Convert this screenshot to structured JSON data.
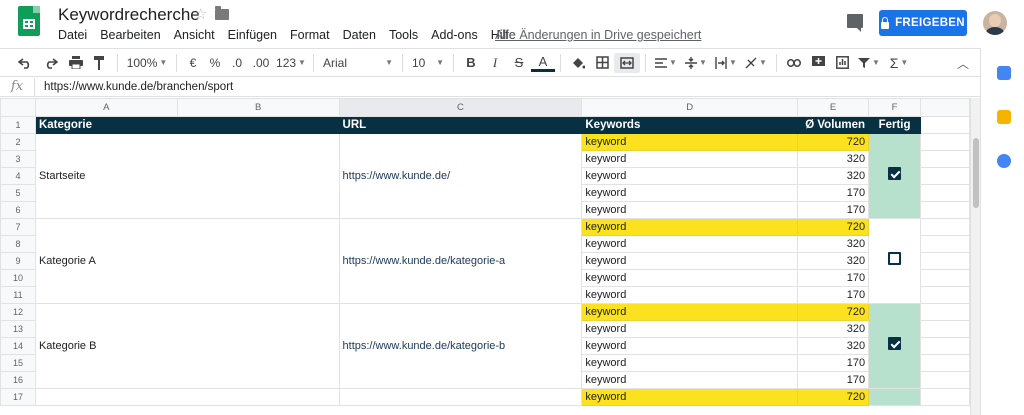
{
  "header": {
    "title": "Keywordrecherche",
    "menu": [
      "Datei",
      "Bearbeiten",
      "Ansicht",
      "Einfügen",
      "Format",
      "Daten",
      "Tools",
      "Add-ons",
      "Hilfe"
    ],
    "save_status": "Alle Änderungen in Drive gespeichert",
    "share_label": "FREIGEBEN"
  },
  "toolbar": {
    "zoom": "100%",
    "currency": "€",
    "percent": "%",
    "dec_less": ".0",
    "dec_more": ".00",
    "more_formats": "123",
    "font": "Arial",
    "font_size": "10",
    "bold": "B",
    "italic": "I",
    "strike": "S",
    "text_color": "A",
    "sum": "Σ"
  },
  "formula_bar": {
    "fx": "fx",
    "value": "https://www.kunde.de/branchen/sport"
  },
  "columns": [
    "A",
    "B",
    "C",
    "D",
    "E",
    "F"
  ],
  "rows": [
    "1",
    "2",
    "3",
    "4",
    "5",
    "6",
    "7",
    "8",
    "9",
    "10",
    "11",
    "12",
    "13",
    "14",
    "15",
    "16",
    "17"
  ],
  "table_header": {
    "kategorie": "Kategorie",
    "url": "URL",
    "keywords": "Keywords",
    "volumen": "Ø Volumen",
    "fertig": "Fertig"
  },
  "groups": [
    {
      "kategorie": "Startseite",
      "url": "https://www.kunde.de/",
      "done": true,
      "keywords": [
        {
          "k": "keyword",
          "v": "720"
        },
        {
          "k": "keyword",
          "v": "320"
        },
        {
          "k": "keyword",
          "v": "320"
        },
        {
          "k": "keyword",
          "v": "170"
        },
        {
          "k": "keyword",
          "v": "170"
        }
      ]
    },
    {
      "kategorie": "Kategorie A",
      "url": "https://www.kunde.de/kategorie-a",
      "done": false,
      "keywords": [
        {
          "k": "keyword",
          "v": "720"
        },
        {
          "k": "keyword",
          "v": "320"
        },
        {
          "k": "keyword",
          "v": "320"
        },
        {
          "k": "keyword",
          "v": "170"
        },
        {
          "k": "keyword",
          "v": "170"
        }
      ]
    },
    {
      "kategorie": "Kategorie B",
      "url": "https://www.kunde.de/kategorie-b",
      "done": true,
      "keywords": [
        {
          "k": "keyword",
          "v": "720"
        },
        {
          "k": "keyword",
          "v": "320"
        },
        {
          "k": "keyword",
          "v": "320"
        },
        {
          "k": "keyword",
          "v": "170"
        },
        {
          "k": "keyword",
          "v": "170"
        }
      ]
    },
    {
      "kategorie": "",
      "url": "",
      "done": true,
      "keywords": [
        {
          "k": "keyword",
          "v": "720"
        }
      ]
    }
  ],
  "colors": {
    "header_bg": "#073042",
    "highlight": "#fce11e",
    "done_bg": "#b7e1cd",
    "share": "#1a73e8"
  }
}
